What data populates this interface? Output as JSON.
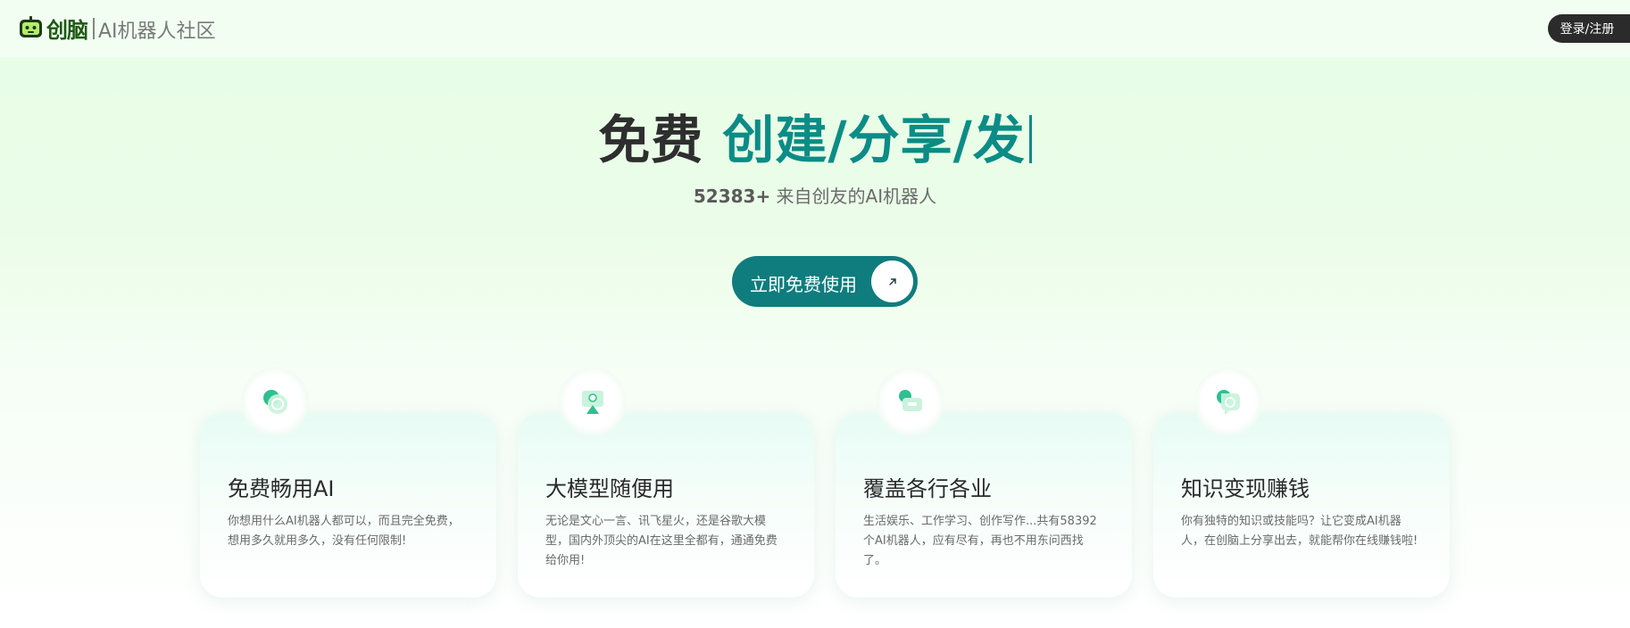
{
  "header": {
    "brand": "创脑",
    "brand_sub": "AI机器人社区",
    "login_label": "登录/注册",
    "logo_icon": "robot-face-icon"
  },
  "hero": {
    "title_lead": "免费",
    "title_accent": "创建/分享/发",
    "count": "52383+",
    "subtitle_rest": " 来自创友的AI机器人",
    "cta_label": "立即免费使用",
    "cta_icon": "arrow-up-right-icon",
    "accent_color": "#0b8c86"
  },
  "features": [
    {
      "title": "免费畅用AI",
      "desc": "你想用什么AI机器人都可以，而且完全免费，想用多久就用多久，没有任何限制!",
      "icon": "ai-chat-icon"
    },
    {
      "title": "大模型随便用",
      "desc": "无论是文心一言、讯飞星火，还是谷歌大模型，国内外顶尖的AI在这里全都有，通通免费给你用!",
      "icon": "monitor-user-icon"
    },
    {
      "title": "覆盖各行各业",
      "desc": "生活娱乐、工作学习、创作写作...共有58392个AI机器人，应有尽有，再也不用东问西找了。",
      "icon": "briefcase-icon"
    },
    {
      "title": "知识变现赚钱",
      "desc": "你有独特的知识或技能吗？让它变成AI机器人，在创脑上分享出去，就能帮你在线赚钱啦!",
      "icon": "ai-bubble-icon"
    }
  ]
}
